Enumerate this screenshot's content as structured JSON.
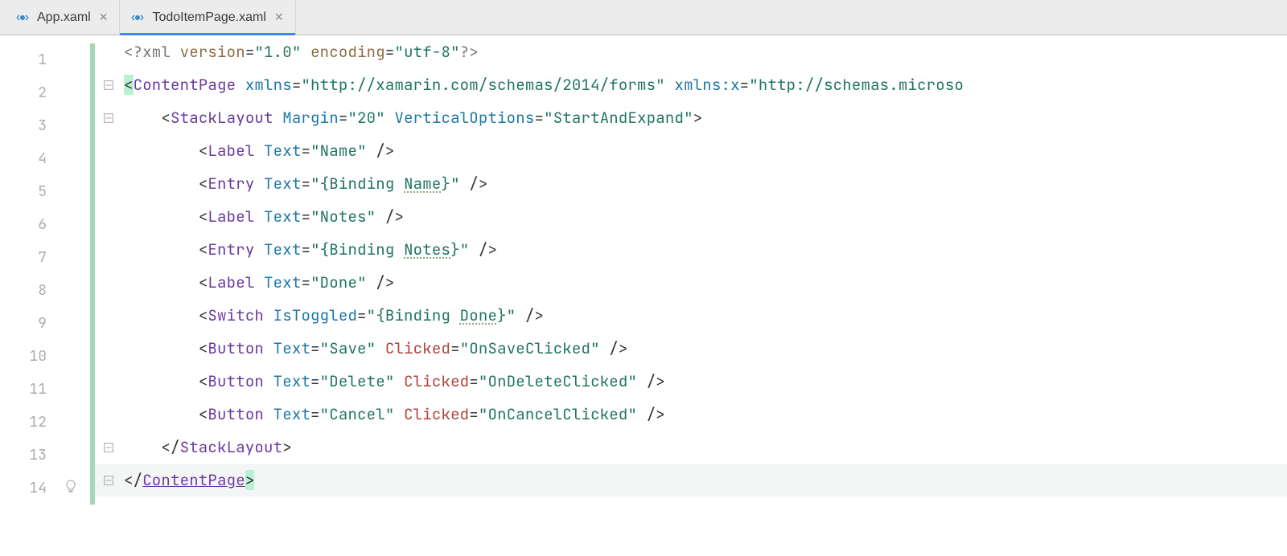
{
  "tabs": [
    {
      "label": "App.xaml",
      "active": false
    },
    {
      "label": "TodoItemPage.xaml",
      "active": true
    }
  ],
  "line_numbers": [
    "1",
    "2",
    "3",
    "4",
    "5",
    "6",
    "7",
    "8",
    "9",
    "10",
    "11",
    "12",
    "13",
    "14"
  ],
  "code": {
    "l1": {
      "open": "<?",
      "xml": "xml",
      "sp1": " ",
      "a1": "version",
      "eq1": "=",
      "v1": "\"1.0\"",
      "sp2": " ",
      "a2": "encoding",
      "eq2": "=",
      "v2": "\"utf-8\"",
      "close": "?>"
    },
    "l2": {
      "open": "<",
      "tag": "ContentPage",
      "sp1": " ",
      "a1": "xmlns",
      "eq1": "=",
      "v1": "\"http://xamarin.com/schemas/2014/forms\"",
      "sp2": " ",
      "a2": "xmlns:x",
      "eq2": "=",
      "v2": "\"http://schemas.microso"
    },
    "l3": {
      "indent": "    ",
      "open": "<",
      "tag": "StackLayout",
      "sp1": " ",
      "a1": "Margin",
      "eq1": "=",
      "v1": "\"20\"",
      "sp2": " ",
      "a2": "VerticalOptions",
      "eq2": "=",
      "v2": "\"StartAndExpand\"",
      "close": ">"
    },
    "l4": {
      "indent": "        ",
      "open": "<",
      "tag": "Label",
      "sp1": " ",
      "a1": "Text",
      "eq1": "=",
      "v1": "\"Name\"",
      "close": " />"
    },
    "l5": {
      "indent": "        ",
      "open": "<",
      "tag": "Entry",
      "sp1": " ",
      "a1": "Text",
      "eq1": "=",
      "v1a": "\"{Binding ",
      "v1b": "Name",
      "v1c": "}\"",
      "close": " />"
    },
    "l6": {
      "indent": "        ",
      "open": "<",
      "tag": "Label",
      "sp1": " ",
      "a1": "Text",
      "eq1": "=",
      "v1": "\"Notes\"",
      "close": " />"
    },
    "l7": {
      "indent": "        ",
      "open": "<",
      "tag": "Entry",
      "sp1": " ",
      "a1": "Text",
      "eq1": "=",
      "v1a": "\"{Binding ",
      "v1b": "Notes",
      "v1c": "}\"",
      "close": " />"
    },
    "l8": {
      "indent": "        ",
      "open": "<",
      "tag": "Label",
      "sp1": " ",
      "a1": "Text",
      "eq1": "=",
      "v1": "\"Done\"",
      "close": " />"
    },
    "l9": {
      "indent": "        ",
      "open": "<",
      "tag": "Switch",
      "sp1": " ",
      "a1": "IsToggled",
      "eq1": "=",
      "v1a": "\"{Binding ",
      "v1b": "Done",
      "v1c": "}\"",
      "close": " />"
    },
    "l10": {
      "indent": "        ",
      "open": "<",
      "tag": "Button",
      "sp1": " ",
      "a1": "Text",
      "eq1": "=",
      "v1": "\"Save\"",
      "sp2": " ",
      "a2": "Clicked",
      "eq2": "=",
      "v2": "\"OnSaveClicked\"",
      "close": " />"
    },
    "l11": {
      "indent": "        ",
      "open": "<",
      "tag": "Button",
      "sp1": " ",
      "a1": "Text",
      "eq1": "=",
      "v1": "\"Delete\"",
      "sp2": " ",
      "a2": "Clicked",
      "eq2": "=",
      "v2": "\"OnDeleteClicked\"",
      "close": " />"
    },
    "l12": {
      "indent": "        ",
      "open": "<",
      "tag": "Button",
      "sp1": " ",
      "a1": "Text",
      "eq1": "=",
      "v1": "\"Cancel\"",
      "sp2": " ",
      "a2": "Clicked",
      "eq2": "=",
      "v2": "\"OnCancelClicked\"",
      "close": " />"
    },
    "l13": {
      "indent": "    ",
      "open": "</",
      "tag": "StackLayout",
      "close": ">"
    },
    "l14": {
      "open": "</",
      "tag": "ContentPage",
      "close": ">"
    }
  }
}
